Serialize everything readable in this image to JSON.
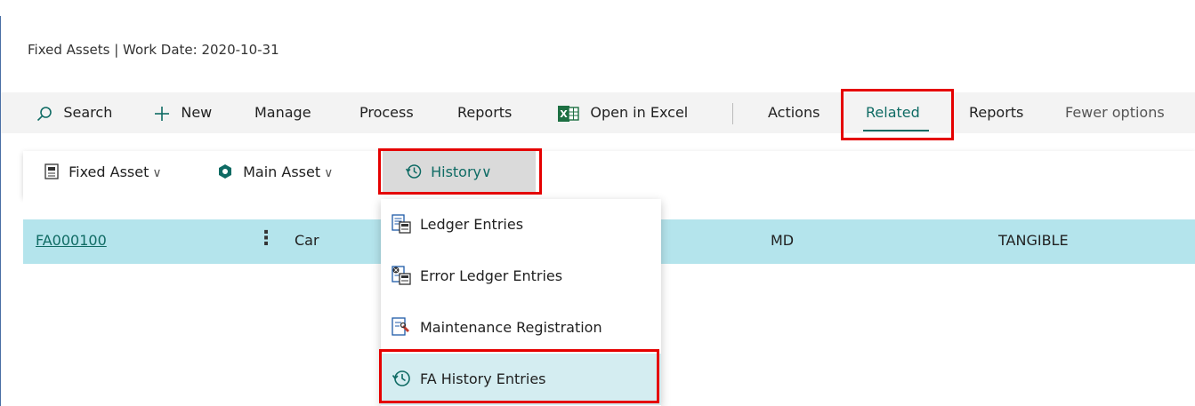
{
  "app": {
    "title": "Fixed Assets | Work Date: 2020-10-31"
  },
  "actions": {
    "search": "Search",
    "new": "New",
    "manage": "Manage",
    "process": "Process",
    "reports": "Reports",
    "open_in_excel": "Open in Excel",
    "actions": "Actions",
    "related": "Related",
    "reports2": "Reports",
    "fewer_options": "Fewer options"
  },
  "subactions": {
    "fixed_asset": "Fixed Asset",
    "main_asset": "Main Asset",
    "history": "History"
  },
  "grid": {
    "rows": [
      {
        "no": "FA000100",
        "description": "Car",
        "responsible_employee": "MD",
        "fa_class_code": "TANGIBLE"
      }
    ]
  },
  "history_menu": {
    "items": [
      {
        "label": "Ledger Entries",
        "icon": "ledger-entries-icon"
      },
      {
        "label": "Error Ledger Entries",
        "icon": "error-ledger-entries-icon"
      },
      {
        "label": "Maintenance Registration",
        "icon": "maintenance-registration-icon"
      },
      {
        "label": "FA History Entries",
        "icon": "history-icon",
        "selected": true
      }
    ]
  },
  "colors": {
    "accent": "#0f6b64",
    "highlight_border": "#e50000",
    "selected_row": "#b4e4ec",
    "selected_menu_item": "#d4edf1"
  }
}
